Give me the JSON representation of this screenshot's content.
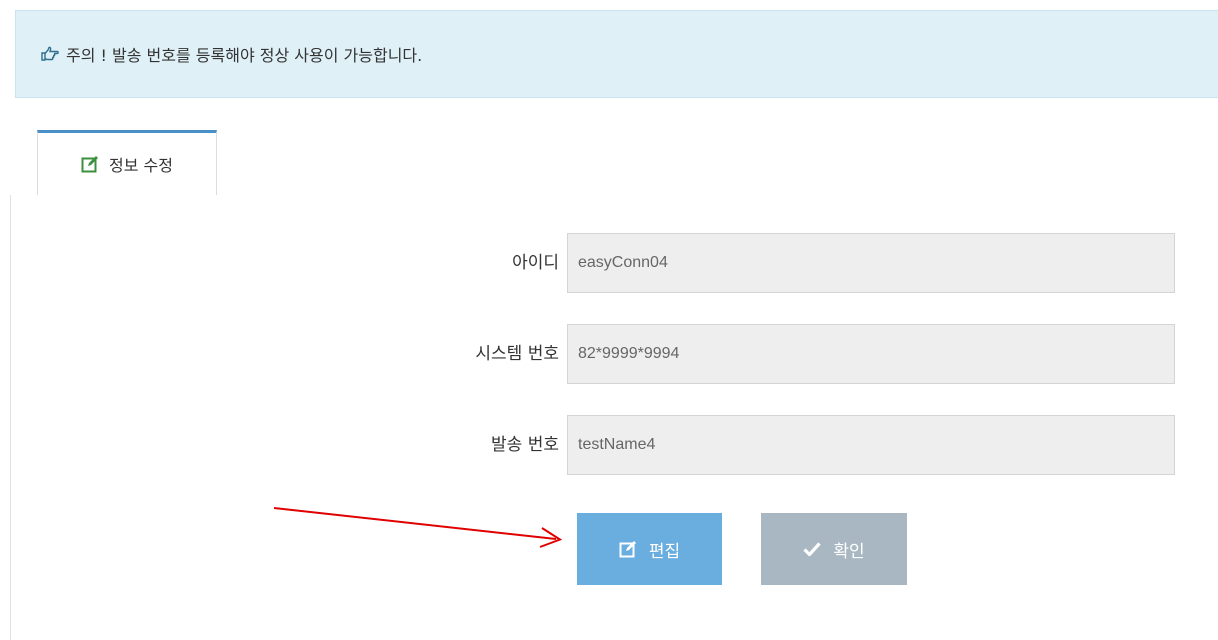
{
  "alert": {
    "icon": "hand-pointing-right-icon",
    "text": "주의 ! 발송 번호를 등록해야 정상 사용이 가능합니다."
  },
  "tab": {
    "icon": "edit-icon",
    "label": "정보 수정"
  },
  "form": {
    "id_label": "아이디",
    "id_value": "easyConn04",
    "system_label": "시스템 번호",
    "system_value": "82*9999*9994",
    "sender_label": "발송 번호",
    "sender_value": "testName4"
  },
  "buttons": {
    "edit_label": "편집",
    "edit_icon": "edit-icon",
    "confirm_label": "확인",
    "confirm_icon": "check-icon"
  },
  "colors": {
    "alert_bg": "#dff0f7",
    "edit_button": "#6aaee0",
    "confirm_button": "#a9b7c2",
    "annotation_arrow": "#e00000"
  }
}
